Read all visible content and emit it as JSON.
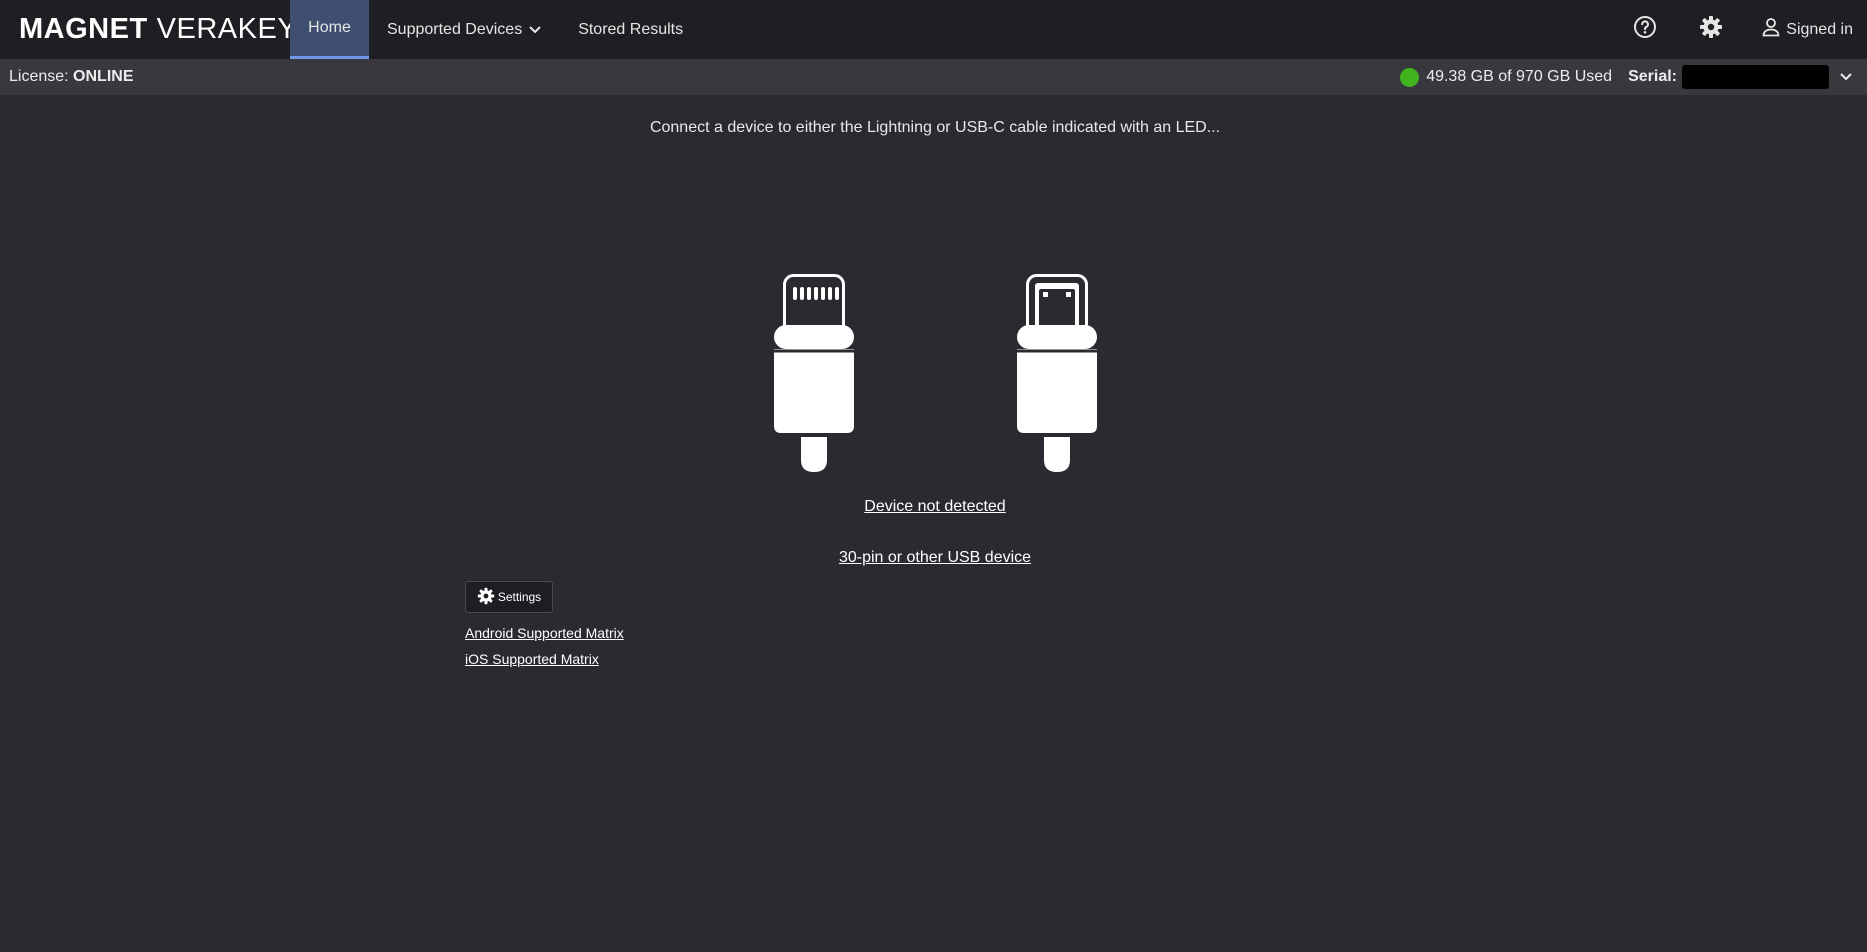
{
  "app": {
    "logo_bold": "MAGNET",
    "logo_light": "VERAKEY"
  },
  "nav": {
    "tabs": [
      {
        "label": "Home",
        "active": true
      },
      {
        "label": "Supported Devices",
        "dropdown": true
      },
      {
        "label": "Stored Results"
      }
    ],
    "user_label": "Signed in",
    "icons": [
      "help-icon",
      "gear-icon",
      "user-icon"
    ]
  },
  "status": {
    "license_label": "License:",
    "license_value": "ONLINE",
    "storage_text": "49.38 GB of 970 GB Used",
    "storage_status_color": "#3fb41c",
    "serial_label": "Serial:"
  },
  "main": {
    "prompt": "Connect a device to either the Lightning or USB-C cable indicated with an LED...",
    "connectors": [
      "lightning-connector-icon",
      "usb-c-connector-icon"
    ],
    "device_status_link": "Device not detected",
    "other_device_link": "30-pin or other USB device",
    "settings_label": "Settings",
    "android_matrix_link": "Android Supported Matrix",
    "ios_matrix_link": "iOS Supported Matrix"
  },
  "colors": {
    "background": "#2b2a30",
    "topbar": "#1f1f23",
    "statusbar": "#39383e",
    "active_tab": "#3e4f72",
    "active_tab_underline": "#6f95e8"
  }
}
